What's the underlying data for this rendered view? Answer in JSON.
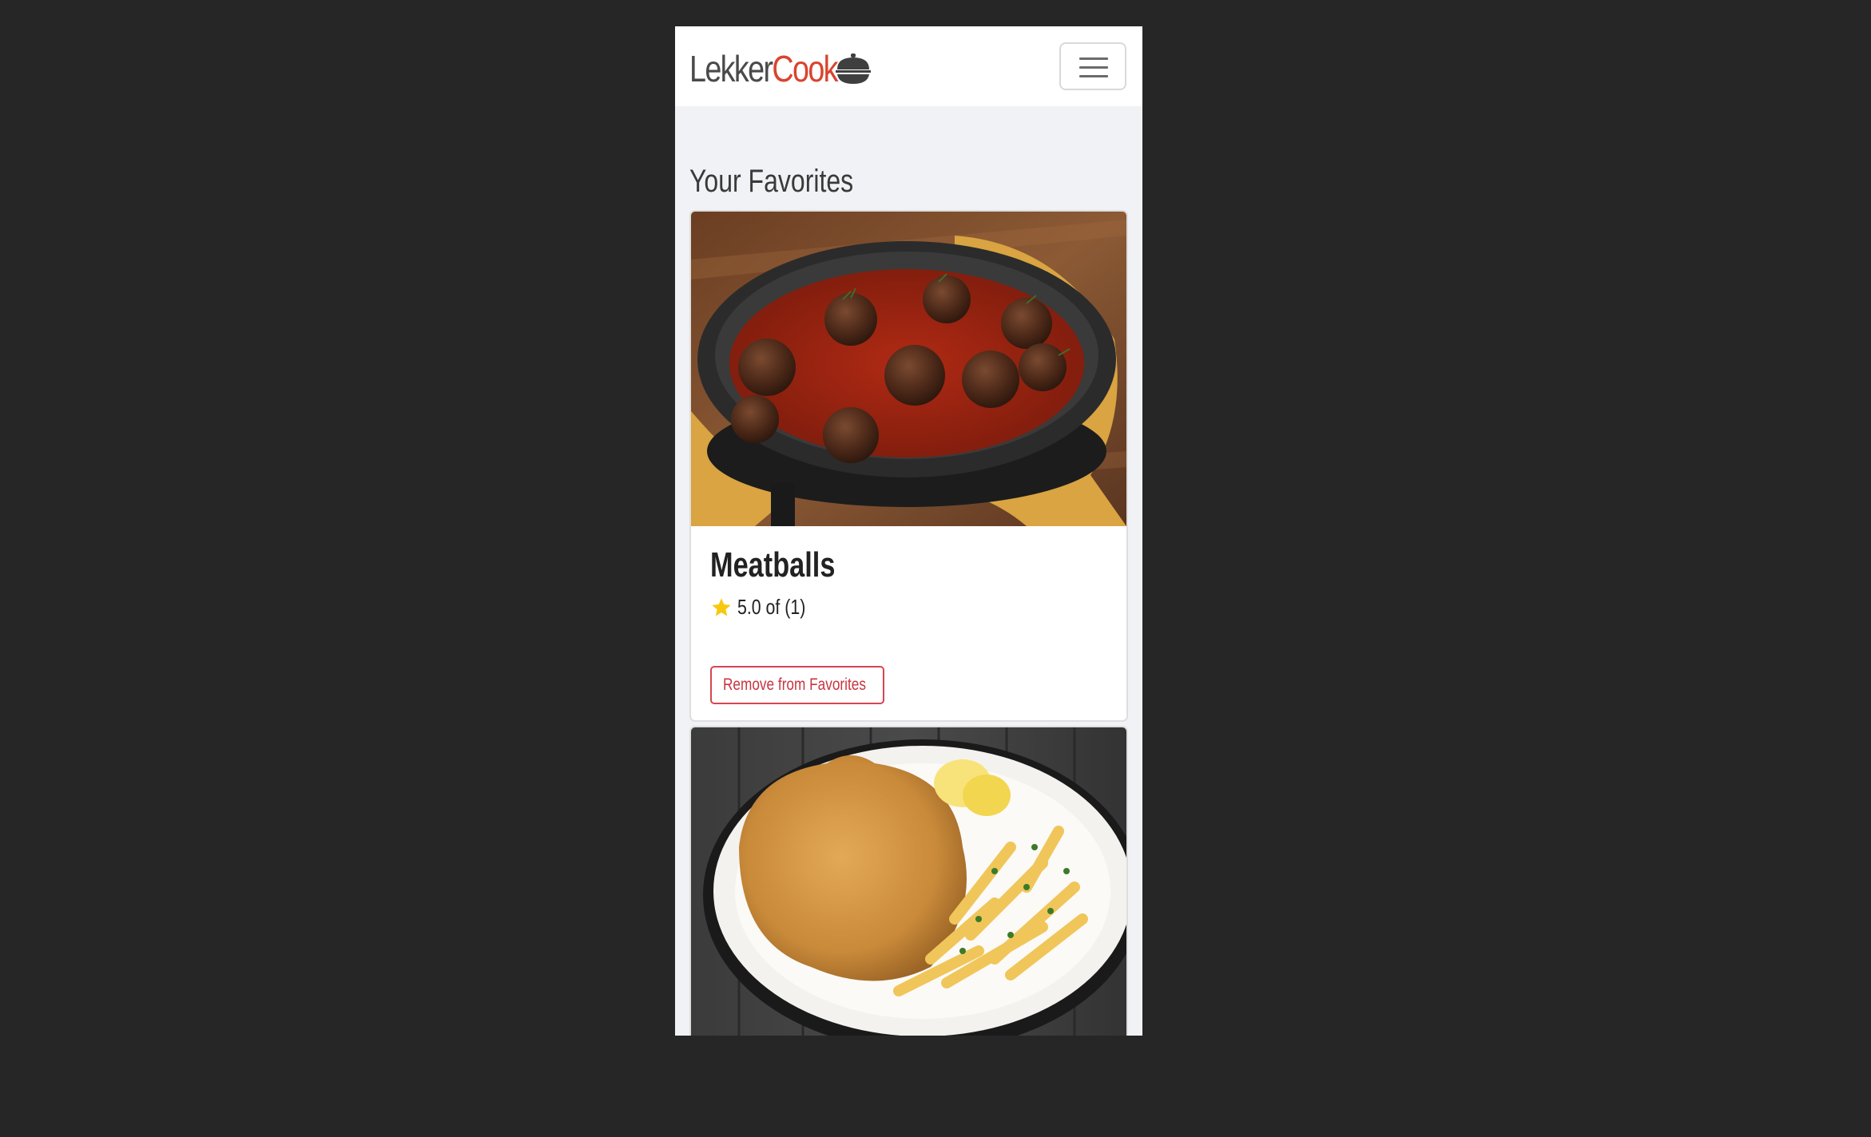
{
  "navbar": {
    "brand_part1": "Lekker",
    "brand_part2": "Cook",
    "brand_icon": "bowl-icon",
    "menu_icon": "hamburger-menu-icon",
    "colors": {
      "brand_dark": "#4a4a4a",
      "brand_accent": "#d9442e"
    }
  },
  "main": {
    "title": "Your Favorites",
    "favorites": [
      {
        "title": "Meatballs",
        "image": "meatballs-in-tomato-sauce-photo",
        "rating_icon": "star-icon",
        "rating_text": "5.0 of (1)",
        "remove_label": "Remove from Favorites"
      },
      {
        "image": "schnitzel-with-fries-photo"
      }
    ]
  },
  "colors": {
    "page_background": "#262626",
    "content_background": "#f1f2f6",
    "danger": "#d64550",
    "star": "#f6c90e"
  }
}
